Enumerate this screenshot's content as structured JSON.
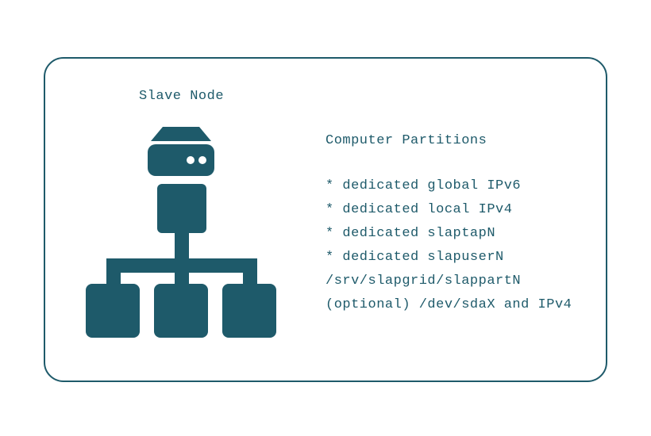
{
  "title": "Slave Node",
  "partitions": {
    "heading": "Computer Partitions",
    "items": [
      "* dedicated global IPv6",
      "* dedicated local IPv4",
      "* dedicated slaptapN",
      "* dedicated slapuserN",
      "/srv/slapgrid/slappartN",
      "(optional) /dev/sdaX and IPv4"
    ]
  },
  "colors": {
    "accent": "#1e5a6a"
  }
}
